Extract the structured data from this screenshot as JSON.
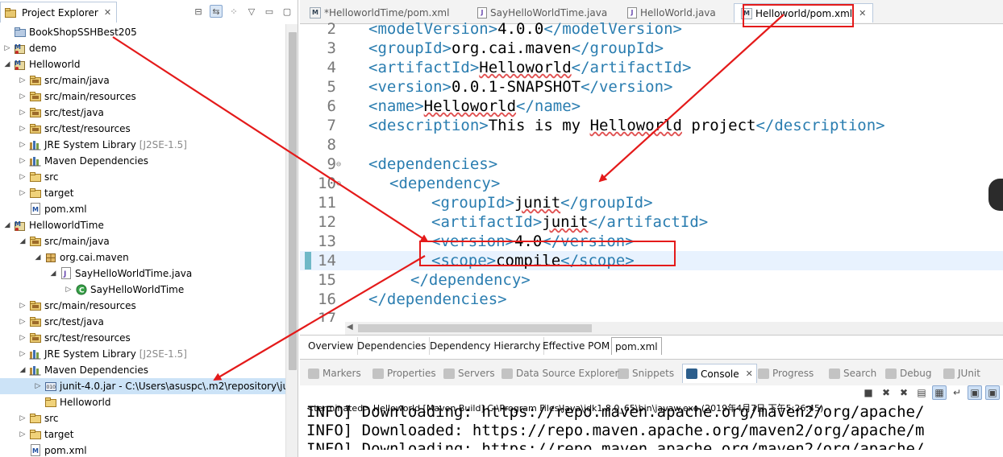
{
  "project_explorer": {
    "tab_title": "Project Explorer",
    "items": [
      {
        "label": "BookShopSSHBest205",
        "decor": "",
        "level": 0,
        "twisty": "",
        "icon": "project-folder-icon",
        "selected": false
      },
      {
        "label": "demo",
        "decor": "",
        "level": 0,
        "twisty": "▷",
        "icon": "maven-project-icon",
        "selected": false
      },
      {
        "label": "Helloworld",
        "decor": "",
        "level": 0,
        "twisty": "◢",
        "icon": "maven-project-icon",
        "selected": false
      },
      {
        "label": "src/main/java",
        "decor": "",
        "level": 1,
        "twisty": "▷",
        "icon": "source-folder-icon",
        "selected": false
      },
      {
        "label": "src/main/resources",
        "decor": "",
        "level": 1,
        "twisty": "▷",
        "icon": "source-folder-icon",
        "selected": false
      },
      {
        "label": "src/test/java",
        "decor": "",
        "level": 1,
        "twisty": "▷",
        "icon": "source-folder-icon",
        "selected": false
      },
      {
        "label": "src/test/resources",
        "decor": "",
        "level": 1,
        "twisty": "▷",
        "icon": "source-folder-icon",
        "selected": false
      },
      {
        "label": "JRE System Library",
        "decor": "[J2SE-1.5]",
        "level": 1,
        "twisty": "▷",
        "icon": "library-icon",
        "selected": false
      },
      {
        "label": "Maven Dependencies",
        "decor": "",
        "level": 1,
        "twisty": "▷",
        "icon": "library-icon",
        "selected": false
      },
      {
        "label": "src",
        "decor": "",
        "level": 1,
        "twisty": "▷",
        "icon": "folder-icon",
        "selected": false
      },
      {
        "label": "target",
        "decor": "",
        "level": 1,
        "twisty": "▷",
        "icon": "folder-icon",
        "selected": false
      },
      {
        "label": "pom.xml",
        "decor": "",
        "level": 1,
        "twisty": "",
        "icon": "pom-file-icon",
        "selected": false
      },
      {
        "label": "HelloworldTime",
        "decor": "",
        "level": 0,
        "twisty": "◢",
        "icon": "maven-project-icon",
        "selected": false
      },
      {
        "label": "src/main/java",
        "decor": "",
        "level": 1,
        "twisty": "◢",
        "icon": "source-folder-icon",
        "selected": false
      },
      {
        "label": "org.cai.maven",
        "decor": "",
        "level": 2,
        "twisty": "◢",
        "icon": "package-icon",
        "selected": false
      },
      {
        "label": "SayHelloWorldTime.java",
        "decor": "",
        "level": 3,
        "twisty": "◢",
        "icon": "java-file-icon",
        "selected": false
      },
      {
        "label": "SayHelloWorldTime",
        "decor": "",
        "level": 4,
        "twisty": "▷",
        "icon": "class-icon",
        "selected": false
      },
      {
        "label": "src/main/resources",
        "decor": "",
        "level": 1,
        "twisty": "▷",
        "icon": "source-folder-icon",
        "selected": false
      },
      {
        "label": "src/test/java",
        "decor": "",
        "level": 1,
        "twisty": "▷",
        "icon": "source-folder-icon",
        "selected": false
      },
      {
        "label": "src/test/resources",
        "decor": "",
        "level": 1,
        "twisty": "▷",
        "icon": "source-folder-icon",
        "selected": false
      },
      {
        "label": "JRE System Library",
        "decor": "[J2SE-1.5]",
        "level": 1,
        "twisty": "▷",
        "icon": "library-icon",
        "selected": false
      },
      {
        "label": "Maven Dependencies",
        "decor": "",
        "level": 1,
        "twisty": "◢",
        "icon": "library-icon",
        "selected": false
      },
      {
        "label": "junit-4.0.jar - C:\\Users\\asuspc\\.m2\\repository\\ju",
        "decor": "",
        "level": 2,
        "twisty": "▷",
        "icon": "jar-icon",
        "selected": true
      },
      {
        "label": "Helloworld",
        "decor": "",
        "level": 2,
        "twisty": "",
        "icon": "folder-icon",
        "selected": false
      },
      {
        "label": "src",
        "decor": "",
        "level": 1,
        "twisty": "▷",
        "icon": "folder-icon",
        "selected": false
      },
      {
        "label": "target",
        "decor": "",
        "level": 1,
        "twisty": "▷",
        "icon": "folder-icon",
        "selected": false
      },
      {
        "label": "pom.xml",
        "decor": "",
        "level": 1,
        "twisty": "",
        "icon": "pom-file-icon",
        "selected": false
      }
    ]
  },
  "editor": {
    "tabs": [
      {
        "label": "*HelloworldTime/pom.xml",
        "icon": "xml-file-icon",
        "active": false
      },
      {
        "label": "SayHelloWorldTime.java",
        "icon": "java-file-icon",
        "active": false
      },
      {
        "label": "HelloWorld.java",
        "icon": "java-file-icon",
        "active": false
      },
      {
        "label": "Helloworld/pom.xml",
        "icon": "xml-file-icon",
        "active": true
      }
    ],
    "lines": [
      {
        "n": "2",
        "fold": "",
        "indent": 0,
        "open": "<modelVersion>",
        "text": "4.0.0",
        "close": "</modelVersion>"
      },
      {
        "n": "3",
        "fold": "",
        "indent": 0,
        "open": "<groupId>",
        "text": "org.cai.maven",
        "close": "</groupId>"
      },
      {
        "n": "4",
        "fold": "",
        "indent": 0,
        "open": "<artifactId>",
        "text": "Helloworld",
        "close": "</artifactId>"
      },
      {
        "n": "5",
        "fold": "",
        "indent": 0,
        "open": "<version>",
        "text": "0.0.1-SNAPSHOT",
        "close": "</version>"
      },
      {
        "n": "6",
        "fold": "",
        "indent": 0,
        "open": "<name>",
        "text": "Helloworld",
        "close": "</name>"
      },
      {
        "n": "7",
        "fold": "",
        "indent": 0,
        "open": "<description>",
        "text": "This is my Helloworld project",
        "close": "</description>"
      },
      {
        "n": "8",
        "fold": "",
        "indent": 0,
        "open": "",
        "text": "",
        "close": ""
      },
      {
        "n": "9",
        "fold": "⊖",
        "indent": 0,
        "open": "<dependencies>",
        "text": "",
        "close": ""
      },
      {
        "n": "10",
        "fold": "⊖",
        "indent": 1,
        "open": "<dependency>",
        "text": "",
        "close": ""
      },
      {
        "n": "11",
        "fold": "",
        "indent": 3,
        "open": "<groupId>",
        "text": "junit",
        "close": "</groupId>"
      },
      {
        "n": "12",
        "fold": "",
        "indent": 3,
        "open": "<artifactId>",
        "text": "junit",
        "close": "</artifactId>"
      },
      {
        "n": "13",
        "fold": "",
        "indent": 3,
        "open": "<version>",
        "text": "4.0",
        "close": "</version>"
      },
      {
        "n": "14",
        "fold": "",
        "indent": 3,
        "open": "<scope>",
        "text": "compile",
        "close": "</scope>"
      },
      {
        "n": "15",
        "fold": "",
        "indent": 2,
        "open": "</dependency>",
        "text": "",
        "close": ""
      },
      {
        "n": "16",
        "fold": "",
        "indent": 0,
        "open": "</dependencies>",
        "text": "",
        "close": ""
      },
      {
        "n": "17",
        "fold": "",
        "indent": 0,
        "open": "",
        "text": "",
        "close": ""
      }
    ],
    "pom_tabs": [
      "Overview",
      "Dependencies",
      "Dependency Hierarchy",
      "Effective POM",
      "pom.xml"
    ]
  },
  "console": {
    "tabs": [
      {
        "label": "Markers",
        "color": "#8a8a8a",
        "active": false
      },
      {
        "label": "Properties",
        "color": "#8a8a8a",
        "active": false
      },
      {
        "label": "Servers",
        "color": "#8a8a8a",
        "active": false
      },
      {
        "label": "Data Source Explorer",
        "color": "#8a8a8a",
        "active": false
      },
      {
        "label": "Snippets",
        "color": "#8a8a8a",
        "active": false
      },
      {
        "label": "Console",
        "color": "#2c5e8c",
        "active": true
      },
      {
        "label": "Progress",
        "color": "#8a8a8a",
        "active": false
      },
      {
        "label": "Search",
        "color": "#8a8a8a",
        "active": false
      },
      {
        "label": "Debug",
        "color": "#8a8a8a",
        "active": false
      },
      {
        "label": "JUnit",
        "color": "#8a8a8a",
        "active": false
      }
    ],
    "status": "<terminated> Helloworld [Maven Build] C:\\Program Files\\Java\\jdk1.8.0_65\\bin\\javaw.exe (2019年4月7日 下午5:26:45)",
    "output_lines": [
      "INFO] Downloading: https://repo.maven.apache.org/maven2/org/apache/",
      "INFO] Downloaded: https://repo.maven.apache.org/maven2/org/apache/m",
      "INFO] Downloading: https://repo.maven.apache.org/maven2/org/apache/"
    ]
  },
  "colors": {
    "annotation": "#e41a1a",
    "xml_tag": "#2a7db0",
    "selection": "#cce3f7"
  }
}
